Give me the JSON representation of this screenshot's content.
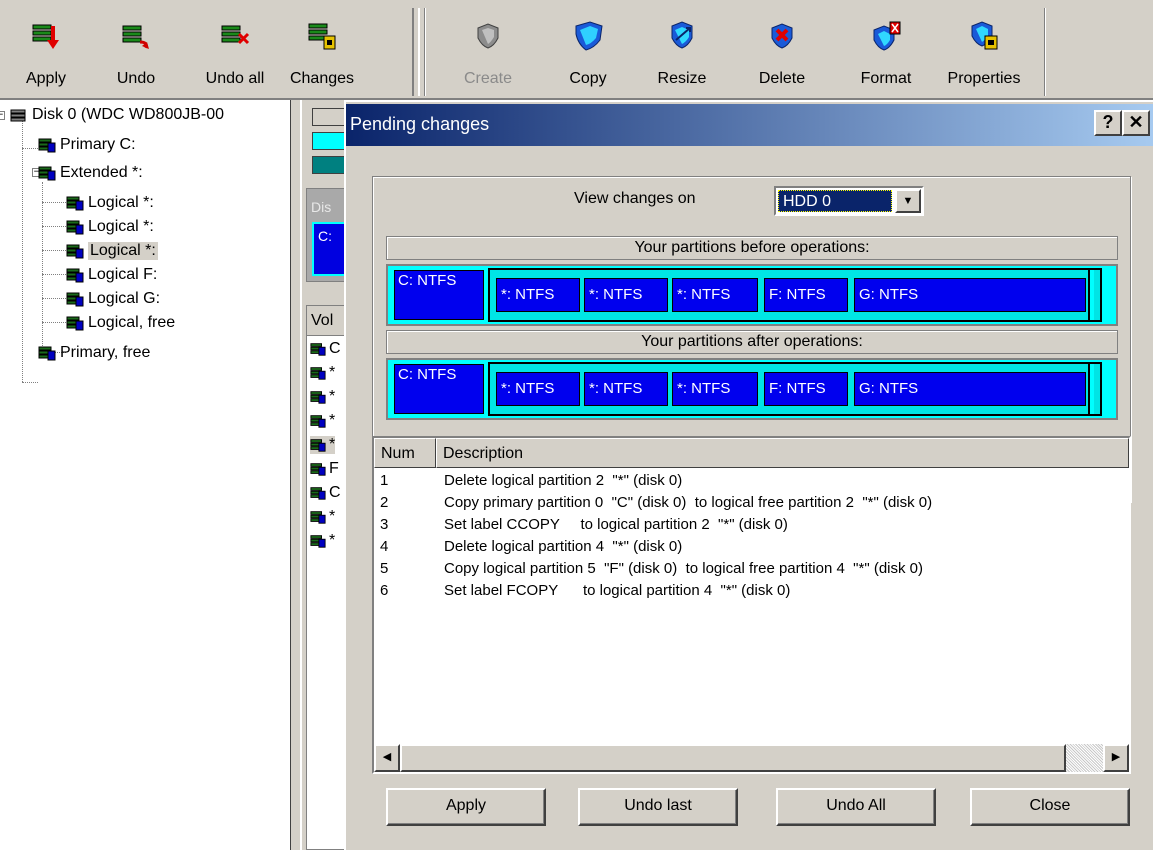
{
  "toolbar": {
    "buttons": [
      {
        "label": "Apply",
        "icon": "apply-icon",
        "enabled": true
      },
      {
        "label": "Undo",
        "icon": "undo-icon",
        "enabled": true
      },
      {
        "label": "Undo all",
        "icon": "undo-all-icon",
        "enabled": true
      },
      {
        "label": "Changes",
        "icon": "changes-icon",
        "enabled": true
      },
      {
        "label": "Create",
        "icon": "create-icon",
        "enabled": false
      },
      {
        "label": "Copy",
        "icon": "copy-icon",
        "enabled": true
      },
      {
        "label": "Resize",
        "icon": "resize-icon",
        "enabled": true
      },
      {
        "label": "Delete",
        "icon": "delete-icon",
        "enabled": true
      },
      {
        "label": "Format",
        "icon": "format-icon",
        "enabled": true
      },
      {
        "label": "Properties",
        "icon": "properties-icon",
        "enabled": true
      }
    ]
  },
  "tree": {
    "items": [
      {
        "label": "Disk 0 (WDC WD800JB-00",
        "icon": "disk-icon"
      },
      {
        "label": "Primary C:",
        "icon": "partition-icon"
      },
      {
        "label": "Extended *:",
        "icon": "partition-icon"
      },
      {
        "label": "Logical *:",
        "icon": "partition-icon"
      },
      {
        "label": "Logical *:",
        "icon": "partition-icon"
      },
      {
        "label": "Logical *:",
        "icon": "partition-icon",
        "selected": true
      },
      {
        "label": "Logical F:",
        "icon": "partition-icon"
      },
      {
        "label": "Logical G:",
        "icon": "partition-icon"
      },
      {
        "label": "Logical, free",
        "icon": "partition-icon"
      },
      {
        "label": "Primary, free",
        "icon": "partition-icon"
      }
    ]
  },
  "background": {
    "disk_label": "Dis",
    "disk_box": "C:",
    "list_header": "Vol",
    "rows": [
      "C",
      "*",
      "*",
      "*",
      "*",
      "F",
      "C",
      "*",
      "*"
    ]
  },
  "dialog": {
    "title": "Pending changes",
    "help_btn": "?",
    "close_btn": "✕",
    "view_changes_label": "View changes on",
    "selected_disk": "HDD 0",
    "before_header": "Your partitions before operations:",
    "after_header": "Your partitions after operations:",
    "before_partitions": [
      "C: NTFS",
      "*: NTFS",
      "*: NTFS",
      "*: NTFS",
      "F: NTFS",
      "G: NTFS"
    ],
    "after_partitions": [
      "C: NTFS",
      "*: NTFS",
      "*: NTFS",
      "*: NTFS",
      "F: NTFS",
      "G: NTFS"
    ],
    "list": {
      "col_num": "Num",
      "col_desc": "Description",
      "rows": [
        {
          "num": "1",
          "desc": "Delete logical partition 2  \"*\" (disk 0)"
        },
        {
          "num": "2",
          "desc": "Copy primary partition 0  \"C\" (disk 0)  to logical free partition 2  \"*\" (disk 0)"
        },
        {
          "num": "3",
          "desc": "Set label CCOPY     to logical partition 2  \"*\" (disk 0)"
        },
        {
          "num": "4",
          "desc": "Delete logical partition 4  \"*\" (disk 0)"
        },
        {
          "num": "5",
          "desc": "Copy logical partition 5  \"F\" (disk 0)  to logical free partition 4  \"*\" (disk 0)"
        },
        {
          "num": "6",
          "desc": "Set label FCOPY      to logical partition 4  \"*\" (disk 0)"
        }
      ]
    },
    "buttons": {
      "apply": "Apply",
      "undo_last": "Undo last",
      "undo_all": "Undo All",
      "close": "Close"
    }
  },
  "colors": {
    "partition_fill": "#0000ee",
    "extended_fill": "#00ffff",
    "title_start": "#0a246a",
    "title_end": "#a6caf0"
  }
}
